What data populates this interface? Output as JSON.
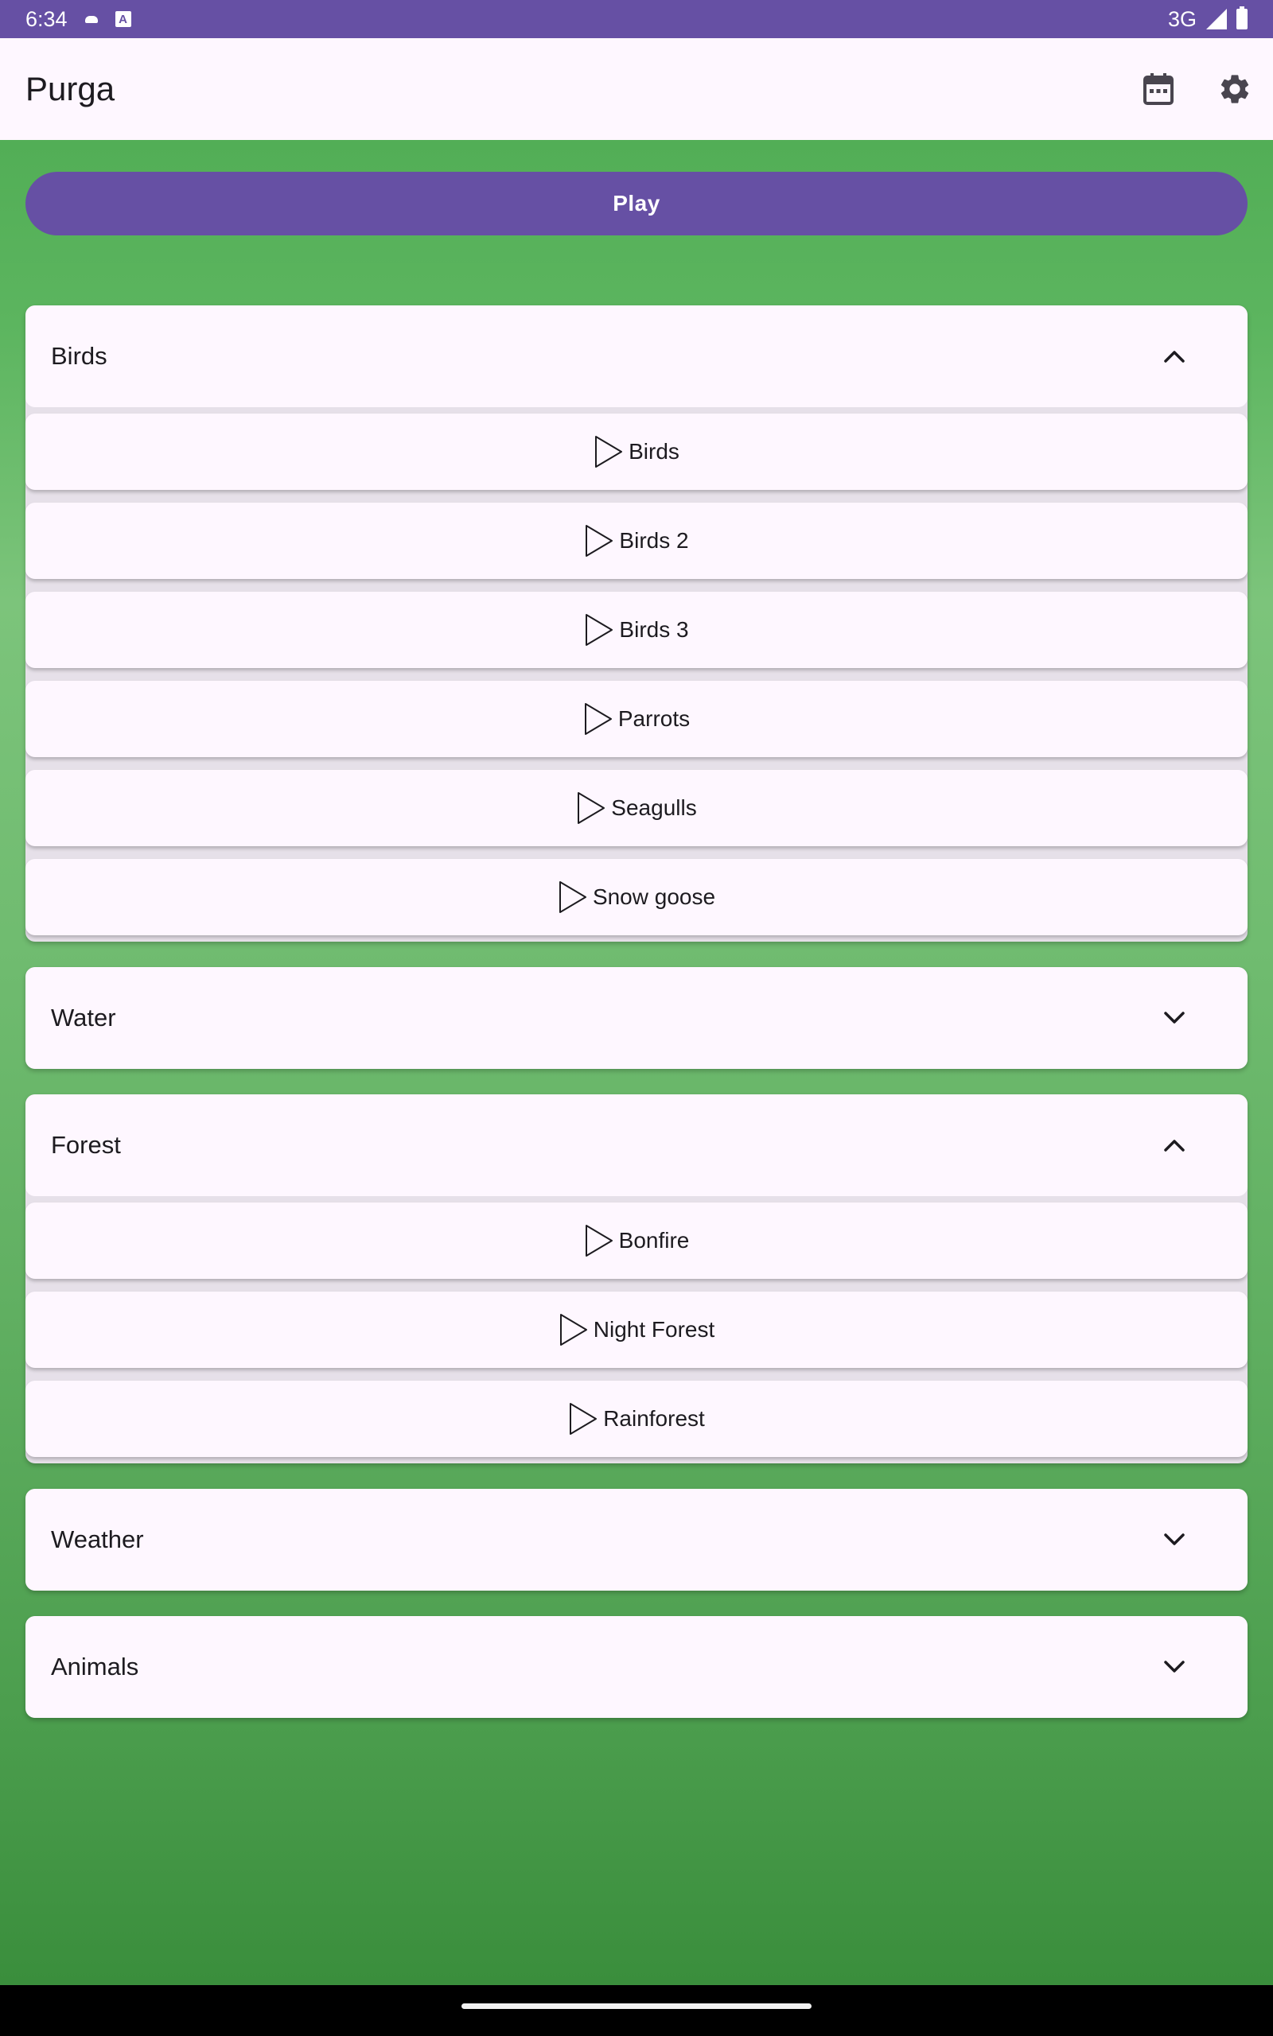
{
  "status_bar": {
    "time": "6:34",
    "network": "3G"
  },
  "app_bar": {
    "title": "Purga",
    "icons": [
      "calendar-icon",
      "settings-gear-icon"
    ]
  },
  "play_button": {
    "label": "Play"
  },
  "groups": [
    {
      "title": "Birds",
      "expanded": true,
      "items": [
        "Birds",
        "Birds 2",
        "Birds 3",
        "Parrots",
        "Seagulls",
        "Snow goose"
      ]
    },
    {
      "title": "Water",
      "expanded": false,
      "items": []
    },
    {
      "title": "Forest",
      "expanded": true,
      "items": [
        "Bonfire",
        "Night Forest",
        "Rainforest"
      ]
    },
    {
      "title": "Weather",
      "expanded": false,
      "items": []
    },
    {
      "title": "Animals",
      "expanded": false,
      "items": []
    }
  ],
  "colors": {
    "primary": "#6650a4",
    "surface": "#fef7ff",
    "background_green": "#5cb55f"
  }
}
